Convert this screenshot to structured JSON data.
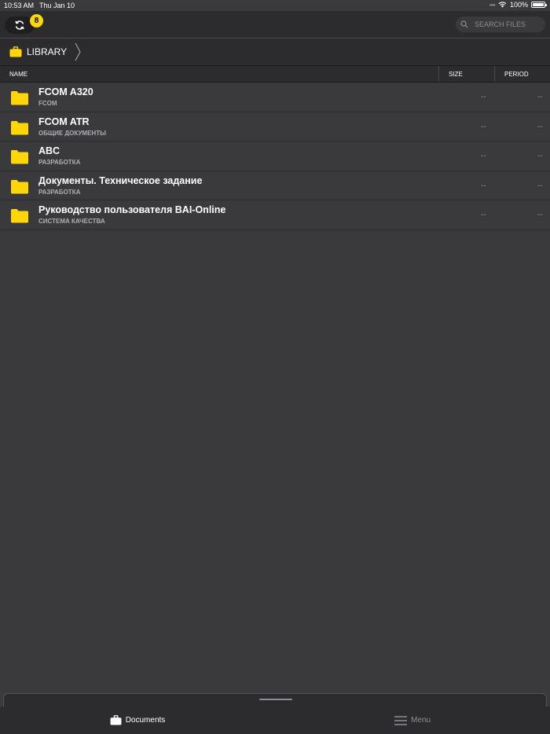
{
  "status_bar": {
    "time": "10:53 AM",
    "date": "Thu Jan 10",
    "battery": "100%"
  },
  "toolbar": {
    "sync_badge": "8",
    "search_placeholder": "SEARCH FILES"
  },
  "breadcrumb": {
    "label": "LIBRARY"
  },
  "table": {
    "columns": {
      "name": "NAME",
      "size": "SIZE",
      "period": "PERIOD"
    },
    "rows": [
      {
        "title": "FCOM A320",
        "subtitle": "FCOM",
        "size": "--",
        "period": "--"
      },
      {
        "title": "FCOM ATR",
        "subtitle": "ОБЩИЕ ДОКУМЕНТЫ",
        "size": "--",
        "period": "--"
      },
      {
        "title": "ABC",
        "subtitle": "РАЗРАБОТКА",
        "size": "--",
        "period": "--"
      },
      {
        "title": "Документы. Техническое задание",
        "subtitle": "РАЗРАБОТКА",
        "size": "--",
        "period": "--"
      },
      {
        "title": "Руководство пользователя BAI-Online",
        "subtitle": "СИСТЕМА КАЧЕСТВА",
        "size": "--",
        "period": "--"
      }
    ]
  },
  "tabbar": {
    "documents": "Documents",
    "menu": "Menu"
  },
  "colors": {
    "accent": "#ffd60a",
    "background": "#3a3a3c",
    "bar": "#2c2c2e"
  },
  "icons": [
    "wifi-icon",
    "battery-icon",
    "sync-icon",
    "search-icon",
    "briefcase-icon",
    "chevron-right-icon",
    "folder-icon",
    "menu-icon"
  ]
}
